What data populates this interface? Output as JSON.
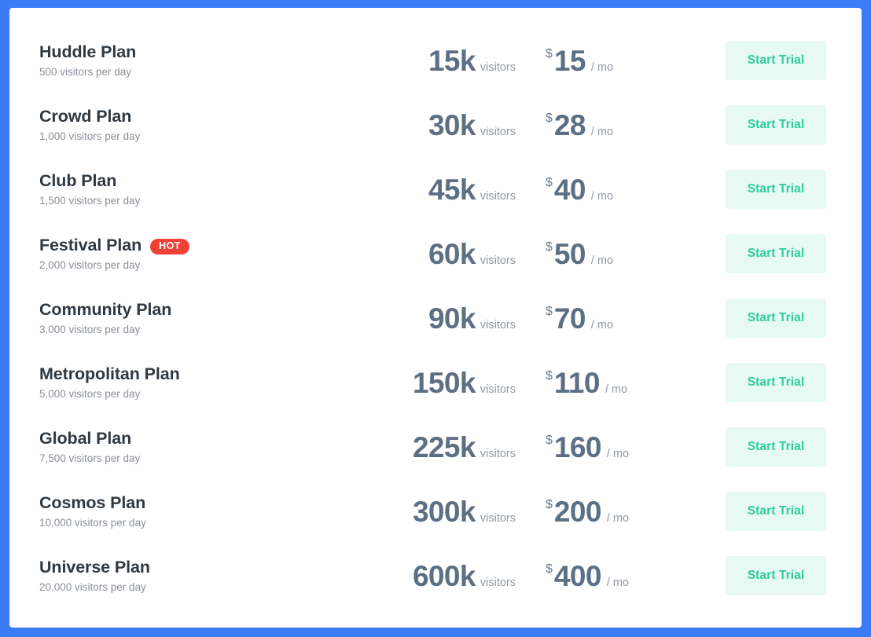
{
  "card": {
    "accent_border_color": "#3b7bf6",
    "background_color": "#ffffff",
    "button_bg_color": "#e6faf3",
    "button_text_color": "#2ecc9f",
    "badge_color": "#ef4136",
    "value_text_color": "#5c6f84",
    "title_text_color": "#2f3943",
    "muted_text_color": "#8b9098"
  },
  "labels": {
    "visitors_suffix": "visitors",
    "currency_symbol": "$",
    "period_suffix": "/ mo",
    "cta": "Start Trial",
    "hot_badge": "HOT"
  },
  "plans": [
    {
      "name": "Huddle Plan",
      "subtitle": "500 visitors per day",
      "visitors": "15k",
      "visitors_suffix": "visitors",
      "currency": "$",
      "price": "15",
      "period": "/ mo",
      "cta": "Start Trial",
      "badge": ""
    },
    {
      "name": "Crowd Plan",
      "subtitle": "1,000 visitors per day",
      "visitors": "30k",
      "visitors_suffix": "visitors",
      "currency": "$",
      "price": "28",
      "period": "/ mo",
      "cta": "Start Trial",
      "badge": ""
    },
    {
      "name": "Club Plan",
      "subtitle": "1,500 visitors per day",
      "visitors": "45k",
      "visitors_suffix": "visitors",
      "currency": "$",
      "price": "40",
      "period": "/ mo",
      "cta": "Start Trial",
      "badge": ""
    },
    {
      "name": "Festival Plan",
      "subtitle": "2,000 visitors per day",
      "visitors": "60k",
      "visitors_suffix": "visitors",
      "currency": "$",
      "price": "50",
      "period": "/ mo",
      "cta": "Start Trial",
      "badge": "HOT"
    },
    {
      "name": "Community Plan",
      "subtitle": "3,000 visitors per day",
      "visitors": "90k",
      "visitors_suffix": "visitors",
      "currency": "$",
      "price": "70",
      "period": "/ mo",
      "cta": "Start Trial",
      "badge": ""
    },
    {
      "name": "Metropolitan Plan",
      "subtitle": "5,000 visitors per day",
      "visitors": "150k",
      "visitors_suffix": "visitors",
      "currency": "$",
      "price": "110",
      "period": "/ mo",
      "cta": "Start Trial",
      "badge": ""
    },
    {
      "name": "Global Plan",
      "subtitle": "7,500 visitors per day",
      "visitors": "225k",
      "visitors_suffix": "visitors",
      "currency": "$",
      "price": "160",
      "period": "/ mo",
      "cta": "Start Trial",
      "badge": ""
    },
    {
      "name": "Cosmos Plan",
      "subtitle": "10,000 visitors per day",
      "visitors": "300k",
      "visitors_suffix": "visitors",
      "currency": "$",
      "price": "200",
      "period": "/ mo",
      "cta": "Start Trial",
      "badge": ""
    },
    {
      "name": "Universe Plan",
      "subtitle": "20,000 visitors per day",
      "visitors": "600k",
      "visitors_suffix": "visitors",
      "currency": "$",
      "price": "400",
      "period": "/ mo",
      "cta": "Start Trial",
      "badge": ""
    }
  ]
}
